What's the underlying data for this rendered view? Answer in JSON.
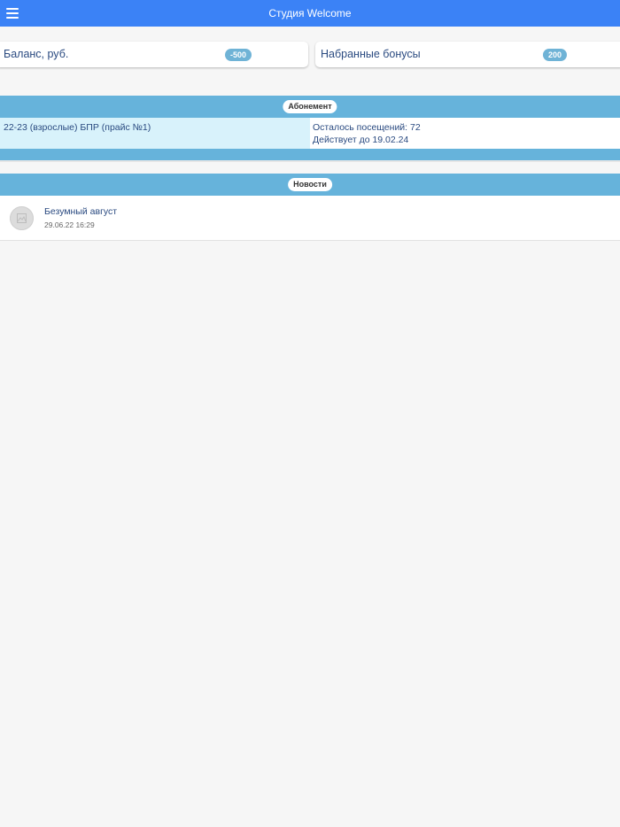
{
  "header": {
    "title": "Студия Welcome",
    "menu_icon": "hamburger-menu-icon",
    "color": "#3b82f6"
  },
  "balance": {
    "label": "Баланс, руб.",
    "value": "-500"
  },
  "bonuses": {
    "label": "Набранные бонусы",
    "value": "200"
  },
  "subscription": {
    "section_title": "Абонемент",
    "name": "22-23 (взрослые) БПР (прайс №1)",
    "visits_left": "Осталось посещений: 72",
    "valid_until": "Действует до 19.02.24"
  },
  "news": {
    "section_title": "Новости",
    "items": [
      {
        "title": "Безумный август",
        "date": "29.06.22 16:29",
        "icon": "image-placeholder-icon"
      }
    ]
  },
  "colors": {
    "accent": "#3b82f6",
    "section": "#66b3db",
    "highlight": "#d8f2fb",
    "text": "#2a4a80"
  }
}
